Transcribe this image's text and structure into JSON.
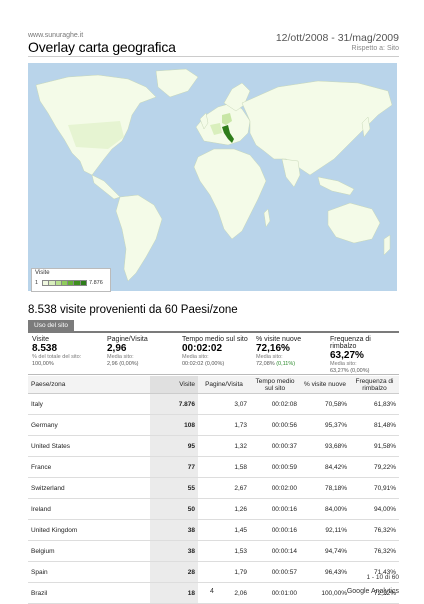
{
  "header": {
    "site": "www.sunuraghe.it",
    "title": "Overlay carta geografica",
    "date_range": "12/ott/2008 - 31/mag/2009",
    "compare": "Rispetto a: Sito"
  },
  "map": {
    "legend_title": "Visite",
    "legend_min": "1",
    "legend_max": "7.876",
    "land_color": "#f4fbe8",
    "ocean_color": "#b9d4ea",
    "highlight_color": "#2e7d1a",
    "legend_colors": [
      "#f0f8e0",
      "#d9efbd",
      "#b8e08e",
      "#8fcc5c",
      "#63b035",
      "#3f8f1f",
      "#2e7d1a"
    ]
  },
  "subtitle": "8.538 visite provenienti da 60 Paesi/zone",
  "tab_label": "Uso del sito",
  "summary": [
    {
      "label": "Visite",
      "value": "8.538",
      "sub1": "% del totale del sito:",
      "sub2": "100,00%",
      "sub2_extra": ""
    },
    {
      "label": "Pagine/Visita",
      "value": "2,96",
      "sub1": "Media sito:",
      "sub2": "2,96",
      "sub2_extra": "(0,00%)"
    },
    {
      "label": "Tempo medio sul sito",
      "value": "00:02:02",
      "sub1": "Media sito:",
      "sub2": "00:02:02",
      "sub2_extra": "(0,00%)"
    },
    {
      "label": "% visite nuove",
      "value": "72,16%",
      "sub1": "Media sito:",
      "sub2": "72,08%",
      "sub2_extra": "(0,11%)"
    },
    {
      "label": "Frequenza di rimbalzo",
      "value": "63,27%",
      "sub1": "Media sito:",
      "sub2": "63,27%",
      "sub2_extra": "(0,00%)"
    }
  ],
  "table": {
    "headers": [
      "Paese/zona",
      "Visite",
      "Pagine/Visita",
      "Tempo medio sul sito",
      "% visite nuove",
      "Frequenza di rimbalzo"
    ],
    "rows": [
      [
        "Italy",
        "7.876",
        "3,07",
        "00:02:08",
        "70,58%",
        "61,83%"
      ],
      [
        "Germany",
        "108",
        "1,73",
        "00:00:56",
        "95,37%",
        "81,48%"
      ],
      [
        "United States",
        "95",
        "1,32",
        "00:00:37",
        "93,68%",
        "91,58%"
      ],
      [
        "France",
        "77",
        "1,58",
        "00:00:59",
        "84,42%",
        "79,22%"
      ],
      [
        "Switzerland",
        "55",
        "2,67",
        "00:02:00",
        "78,18%",
        "70,91%"
      ],
      [
        "Ireland",
        "50",
        "1,26",
        "00:00:16",
        "84,00%",
        "94,00%"
      ],
      [
        "United Kingdom",
        "38",
        "1,45",
        "00:00:16",
        "92,11%",
        "76,32%"
      ],
      [
        "Belgium",
        "38",
        "1,53",
        "00:00:14",
        "94,74%",
        "76,32%"
      ],
      [
        "Spain",
        "28",
        "1,79",
        "00:00:57",
        "96,43%",
        "71,43%"
      ],
      [
        "Brazil",
        "18",
        "2,06",
        "00:01:00",
        "100,00%",
        "72,22%"
      ]
    ]
  },
  "pager": "1 - 10 di 60",
  "footer": {
    "page_number": "4",
    "brand": "Google Analytics"
  }
}
